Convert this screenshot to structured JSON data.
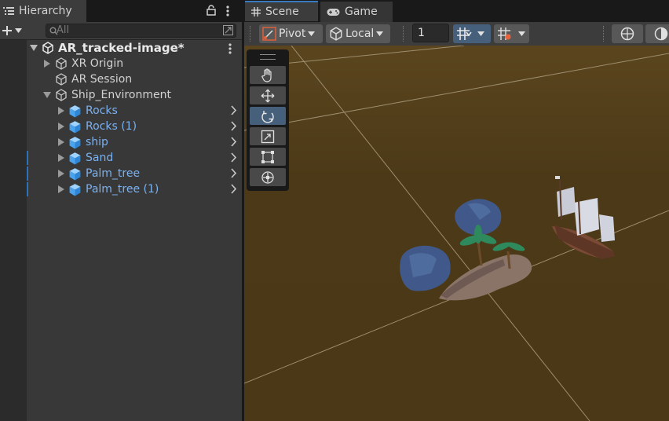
{
  "hierarchy": {
    "title": "Hierarchy",
    "search_placeholder": "All",
    "scene_name": "AR_tracked-image*",
    "items": [
      {
        "label": "XR Origin"
      },
      {
        "label": "AR Session"
      },
      {
        "label": "Ship_Environment"
      },
      {
        "label": "Rocks"
      },
      {
        "label": "Rocks (1)"
      },
      {
        "label": "ship"
      },
      {
        "label": "Sand"
      },
      {
        "label": "Palm_tree"
      },
      {
        "label": "Palm_tree (1)"
      }
    ]
  },
  "scene": {
    "tabs": [
      {
        "label": "Scene"
      },
      {
        "label": "Game"
      }
    ],
    "pivot_label": "Pivot",
    "local_label": "Local",
    "grid_value": "1"
  },
  "colors": {
    "ground": "#4a3816",
    "prefab_text": "#7cb1ef",
    "active_tool": "#46607c",
    "selection_accent": "#2d71bd"
  }
}
